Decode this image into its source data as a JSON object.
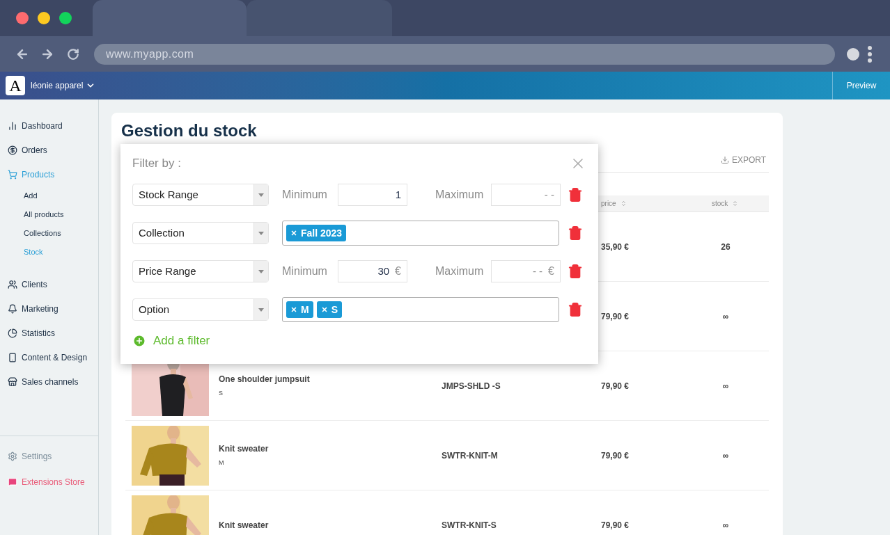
{
  "browser": {
    "url": "www.myapp.com"
  },
  "header": {
    "logo_letter": "A",
    "store": "léonie apparel",
    "preview": "Preview"
  },
  "sidebar": {
    "items": [
      {
        "kind": "dashboard",
        "label": "Dashboard",
        "selected": false
      },
      {
        "kind": "orders",
        "label": "Orders",
        "selected": false
      },
      {
        "kind": "products",
        "label": "Products",
        "selected": true,
        "children": [
          {
            "label": "Add",
            "selected": false
          },
          {
            "label": "All products",
            "selected": false
          },
          {
            "label": "Collections",
            "selected": false
          },
          {
            "label": "Stock",
            "selected": true
          }
        ]
      },
      {
        "kind": "clients",
        "label": "Clients",
        "selected": false
      },
      {
        "kind": "marketing",
        "label": "Marketing",
        "selected": false
      },
      {
        "kind": "statistics",
        "label": "Statistics",
        "selected": false
      },
      {
        "kind": "content",
        "label": "Content & Design",
        "selected": false
      },
      {
        "kind": "sales",
        "label": "Sales channels",
        "selected": false
      }
    ],
    "footer": [
      {
        "kind": "settings",
        "label": "Settings"
      },
      {
        "kind": "extensions",
        "label": "Extensions Store"
      }
    ]
  },
  "page": {
    "title": "Gestion du stock",
    "export": "EXPORT"
  },
  "table": {
    "columns": [
      {
        "label": "price"
      },
      {
        "label": "stock"
      }
    ],
    "rows": [
      {
        "price": "35,90 €",
        "stock": "26"
      },
      {
        "price": "79,90 €",
        "stock": "∞"
      },
      {
        "name": "One shoulder jumpsuit",
        "variant": "S",
        "sku": "JMPS-SHLD -S",
        "price": "79,90 €",
        "stock": "∞"
      },
      {
        "name": "Knit sweater",
        "variant": "M",
        "sku": "SWTR-KNIT-M",
        "price": "79,90 €",
        "stock": "∞"
      },
      {
        "name": "Knit sweater",
        "sku": "SWTR-KNIT-S",
        "price": "79,90 €",
        "stock": "∞"
      }
    ]
  },
  "filter_dialog": {
    "title": "Filter by :",
    "filters": [
      {
        "kind": "range",
        "field": "Stock Range",
        "min_label": "Minimum",
        "min_value": "1",
        "max_label": "Maximum",
        "max_placeholder": "- -"
      },
      {
        "kind": "tags",
        "field": "Collection",
        "tags": [
          "Fall 2023"
        ]
      },
      {
        "kind": "range",
        "field": "Price Range",
        "min_label": "Minimum",
        "min_value": "30",
        "min_unit": "€",
        "max_label": "Maximum",
        "max_placeholder": "- -",
        "max_unit": "€"
      },
      {
        "kind": "tags",
        "field": "Option",
        "tags": [
          "M",
          "S"
        ]
      }
    ],
    "add": "Add a filter"
  }
}
